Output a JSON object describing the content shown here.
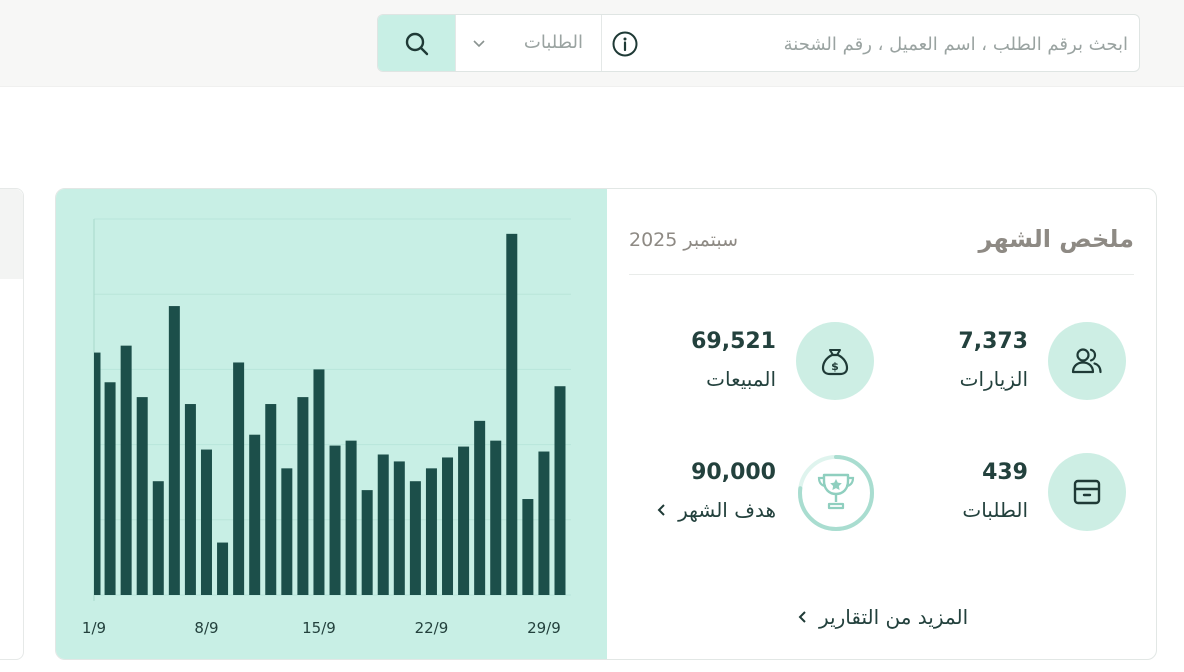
{
  "search": {
    "placeholder": "ابحث برقم الطلب ، اسم العميل ، رقم الشحنة",
    "scope_selected": "الطلبات"
  },
  "icons": {
    "search": "search-icon",
    "info": "info-icon",
    "chevron": "chevron-down-icon",
    "users": "users-icon",
    "money_bag": "money-bag-icon",
    "box": "box-icon",
    "trophy": "trophy-icon"
  },
  "colors": {
    "accent_light": "#c8efe5",
    "bar": "#1c4f4a",
    "text": "#23413d",
    "muted": "#8e8a84"
  },
  "summary": {
    "title": "ملخص الشهر",
    "period": "سبتمبر 2025",
    "visits": {
      "value": "7,373",
      "label": "الزيارات"
    },
    "sales": {
      "value": "69,521",
      "label": "المبيعات"
    },
    "orders": {
      "value": "439",
      "label": "الطلبات"
    },
    "goal": {
      "value": "90,000",
      "label": "هدف الشهر",
      "progress": 0.77
    },
    "more_link": "المزيد من التقارير"
  },
  "chart_data": {
    "type": "bar",
    "title": "",
    "xlabel": "",
    "ylabel": "",
    "x_tick_labels": [
      "1/9",
      "8/9",
      "15/9",
      "22/9",
      "29/9"
    ],
    "categories": [
      "1/9",
      "2/9",
      "3/9",
      "4/9",
      "5/9",
      "6/9",
      "7/9",
      "8/9",
      "9/9",
      "10/9",
      "11/9",
      "12/9",
      "13/9",
      "14/9",
      "15/9",
      "16/9",
      "17/9",
      "18/9",
      "19/9",
      "20/9",
      "21/9",
      "22/9",
      "23/9",
      "24/9",
      "25/9",
      "26/9",
      "27/9",
      "28/9",
      "29/9",
      "30/9"
    ],
    "values": [
      245,
      215,
      252,
      200,
      115,
      292,
      193,
      147,
      53,
      235,
      162,
      193,
      128,
      200,
      228,
      151,
      156,
      106,
      142,
      135,
      115,
      128,
      139,
      150,
      176,
      156,
      365,
      97,
      145,
      211
    ],
    "ylim": [
      0,
      380
    ],
    "grid": true
  }
}
